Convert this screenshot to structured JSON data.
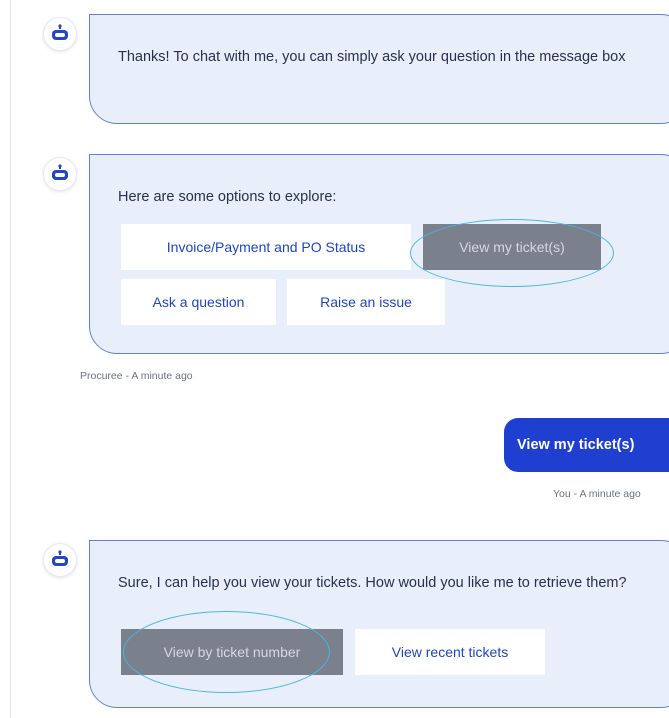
{
  "messages": {
    "welcome": {
      "text": "Thanks! To chat with me, you can simply ask your question in the message box"
    },
    "options": {
      "intro": "Here are some options to explore:",
      "buttons": [
        "Invoice/Payment and PO Status",
        "View my ticket(s)",
        "Ask a question",
        "Raise an issue"
      ],
      "selected": "View my ticket(s)",
      "meta": "Procuree - A minute ago"
    },
    "user_reply": {
      "text": "View my ticket(s)",
      "meta": "You - A minute ago"
    },
    "tickets": {
      "text": "Sure, I can help you view your tickets. How would you like me to retrieve them?",
      "buttons": [
        "View by ticket number",
        "View recent tickets"
      ],
      "selected": "View by ticket number"
    }
  },
  "icons": {
    "bot_avatar": "bot-icon"
  },
  "colors": {
    "bubble_bg": "#e8eefa",
    "bubble_border": "#5b84d6",
    "user_bubble": "#1e3fd0",
    "button_text": "#1f45c4",
    "selected_button": "#7a808c",
    "highlight_ring": "#48b6e6"
  }
}
